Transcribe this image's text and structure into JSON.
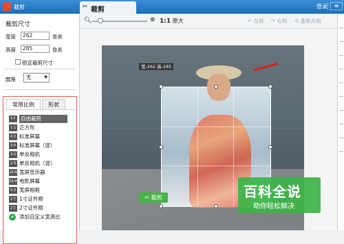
{
  "titlebar": {
    "app_name": "裁剪",
    "tab_label": "裁剪",
    "login": "登录"
  },
  "sidebar": {
    "section_title": "裁剪尺寸",
    "width_label": "宽度",
    "width_value": "262",
    "width_unit": "像素",
    "height_label": "高度",
    "height_value": "285",
    "height_unit": "像素",
    "lock_label": "锁定裁剪尺寸",
    "corner_label": "圆角",
    "corner_value": "无"
  },
  "ratio_panel": {
    "tabs": [
      "常用比例",
      "形状"
    ],
    "items": [
      {
        "icon": "F:F",
        "label": "自由裁剪"
      },
      {
        "icon": "1:1",
        "label": "正方形"
      },
      {
        "icon": "4:3",
        "label": "标准屏幕"
      },
      {
        "icon": "3:4",
        "label": "标准屏幕（竖）"
      },
      {
        "icon": "3:2",
        "label": "单反相机"
      },
      {
        "icon": "2:3",
        "label": "单反相机（竖）"
      },
      {
        "icon": "16:9",
        "label": "宽屏显示器"
      },
      {
        "icon": "16:9",
        "label": "电影屏幕"
      },
      {
        "icon": "5:3",
        "label": "宽屏相框"
      },
      {
        "icon": "1寸",
        "label": "1寸证件照"
      },
      {
        "icon": "2寸",
        "label": "2寸证件照"
      }
    ],
    "add_label": "添加自定义宽高比"
  },
  "toolbar": {
    "orig_ratio": "1:1",
    "orig_label": "原大",
    "rotate_left": "左转",
    "rotate_right": "右转",
    "reset": "重新开始"
  },
  "canvas": {
    "dim_label": "宽:262 高:285",
    "crop_button": "裁剪"
  },
  "watermark": {
    "title": "百科全说",
    "subtitle": "助你轻松解决"
  },
  "colors": {
    "accent_blue": "#1e6db8",
    "crop_green": "#4bb247",
    "highlight_red": "#e45a4a"
  }
}
